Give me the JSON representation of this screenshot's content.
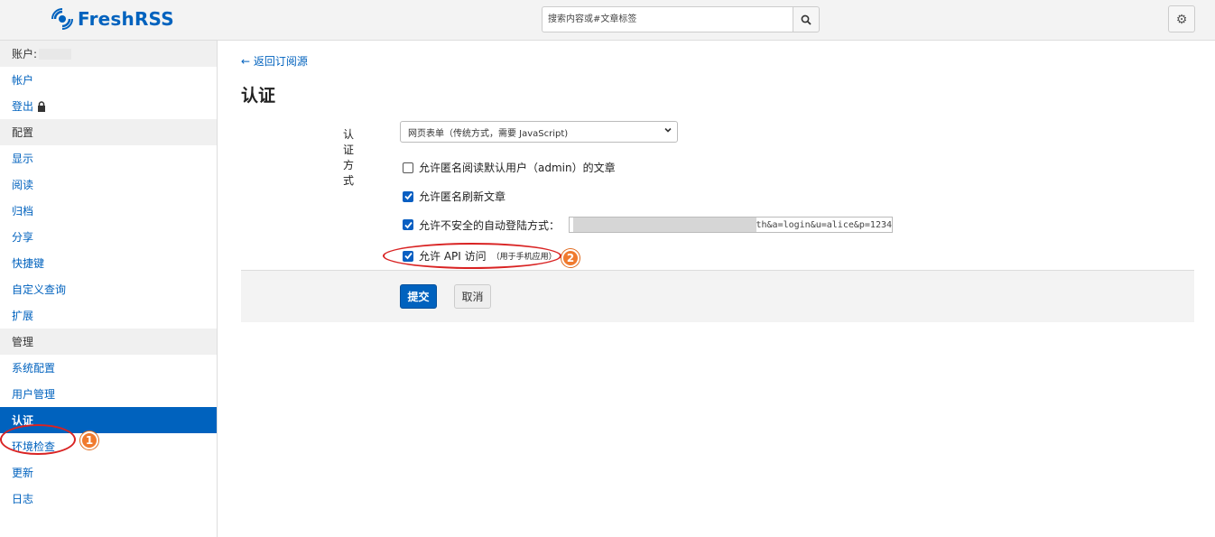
{
  "header": {
    "brand": "FreshRSS",
    "search_placeholder": "搜索内容或#文章标签"
  },
  "sidebar": {
    "sections": [
      {
        "title": "账户:",
        "items": [
          "帐户",
          "登出"
        ]
      },
      {
        "title": "配置",
        "items": [
          "显示",
          "阅读",
          "归档",
          "分享",
          "快捷键",
          "自定义查询",
          "扩展"
        ]
      },
      {
        "title": "管理",
        "items": [
          "系统配置",
          "用户管理",
          "认证",
          "环境检查",
          "更新",
          "日志"
        ]
      }
    ],
    "active": "认证"
  },
  "main": {
    "back_link": "← 返回订阅源",
    "title": "认证",
    "auth_label": "认证方式",
    "auth_select": "网页表单（传统方式，需要 JavaScript)",
    "opt_anon_read": "允许匿名阅读默认用户（admin）的文章",
    "opt_anon_refresh": "允许匿名刷新文章",
    "opt_unsafe_login": "允许不安全的自动登陆方式：",
    "unsafe_url_tail": "th&a=login&u=alice&p=1234",
    "opt_api": "允许 API 访问",
    "opt_api_note": "（用于手机应用）",
    "submit": "提交",
    "cancel": "取消",
    "checks": {
      "anon_read": false,
      "anon_refresh": true,
      "unsafe_login": true,
      "api": true
    }
  },
  "annotations": [
    "1",
    "2"
  ],
  "colors": {
    "accent": "#0062be",
    "marker": "#f07a2e",
    "ring": "#d92323"
  }
}
